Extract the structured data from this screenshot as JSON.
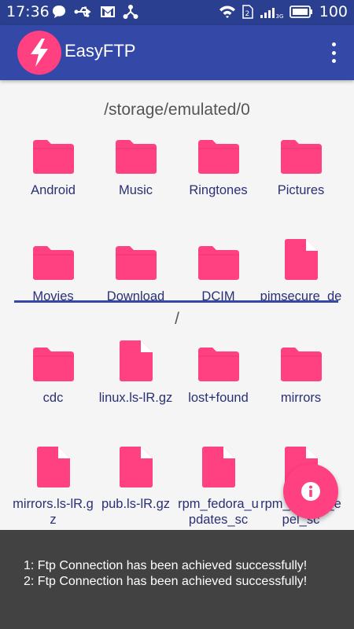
{
  "status_bar": {
    "time": "17:36",
    "battery": "100",
    "left_icons": [
      "chat-icon",
      "usb-icon",
      "gmail-icon",
      "share-icon"
    ],
    "right_icons": [
      "wifi-icon",
      "sim-icon",
      "signal-icon",
      "network-3g",
      "battery-icon"
    ]
  },
  "app_bar": {
    "title": "EasyFTP",
    "accent": "#ff4081",
    "bar_color": "#3448a8"
  },
  "local_pane": {
    "path": "/storage/emulated/0",
    "items": [
      {
        "name": "Android",
        "type": "folder"
      },
      {
        "name": "Music",
        "type": "folder"
      },
      {
        "name": "Ringtones",
        "type": "folder"
      },
      {
        "name": "Pictures",
        "type": "folder"
      },
      {
        "name": "Movies",
        "type": "folder"
      },
      {
        "name": "Download",
        "type": "folder"
      },
      {
        "name": "DCIM",
        "type": "folder"
      },
      {
        "name": "pimsecure_debug.txt",
        "type": "file"
      }
    ]
  },
  "remote_pane": {
    "path": "/",
    "items": [
      {
        "name": "cdc",
        "type": "folder"
      },
      {
        "name": "linux.ls-lR.gz",
        "type": "file"
      },
      {
        "name": "lost+found",
        "type": "folder"
      },
      {
        "name": "mirrors",
        "type": "folder"
      },
      {
        "name": "mirrors.ls-lR.gz",
        "type": "file"
      },
      {
        "name": "pub.ls-lR.gz",
        "type": "file"
      },
      {
        "name": "rpm_fedora_updates_sc",
        "type": "file"
      },
      {
        "name": "rpm_fedora_epel_sc",
        "type": "file"
      }
    ]
  },
  "fab": {
    "icon": "info-icon"
  },
  "log": {
    "lines": [
      "1: Ftp Connection has been achieved successfully!",
      "2: Ftp Connection has been achieved successfully!"
    ]
  }
}
